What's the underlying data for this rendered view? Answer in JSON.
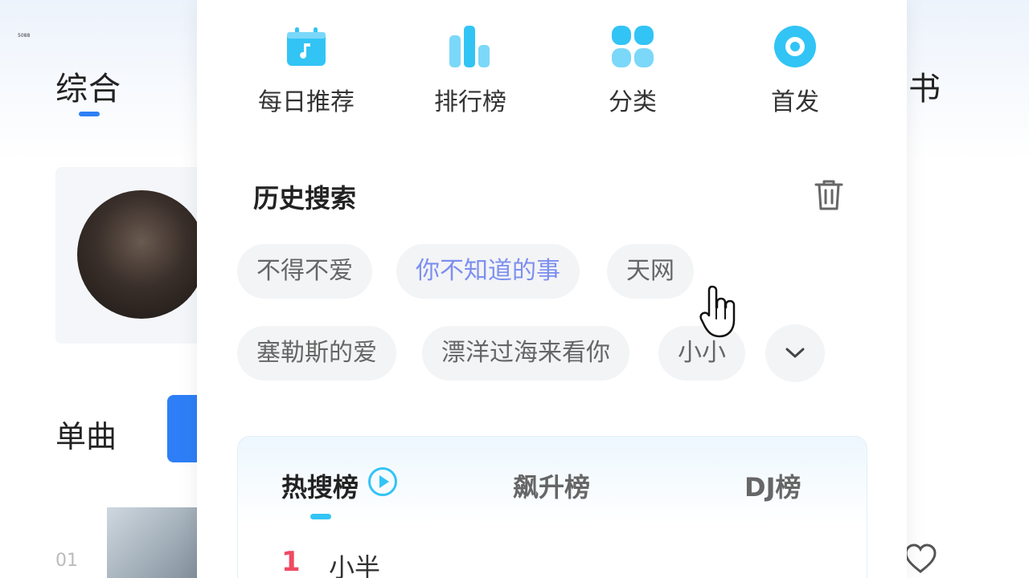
{
  "background": {
    "tiny_label": "5088",
    "tab_label": "综合",
    "right_char": "书",
    "section_label": "单曲",
    "row_number": "01"
  },
  "quick_links": [
    {
      "label": "每日推荐",
      "icon": "calendar-music-icon"
    },
    {
      "label": "排行榜",
      "icon": "bar-chart-icon"
    },
    {
      "label": "分类",
      "icon": "grid-icon"
    },
    {
      "label": "首发",
      "icon": "disc-icon"
    }
  ],
  "history": {
    "title": "历史搜索",
    "chips": [
      "不得不爱",
      "你不知道的事",
      "天网",
      "塞勒斯的爱",
      "漂洋过海来看你",
      "小小"
    ]
  },
  "charts": {
    "tabs": [
      "热搜榜",
      "飙升榜",
      "DJ榜"
    ],
    "first_rank": "1",
    "first_song": "小半"
  },
  "colors": {
    "accent": "#32c4f5",
    "active_chip": "#7d8ff0",
    "rank_red": "#f04a63",
    "primary_blue": "#2e7ff7"
  }
}
